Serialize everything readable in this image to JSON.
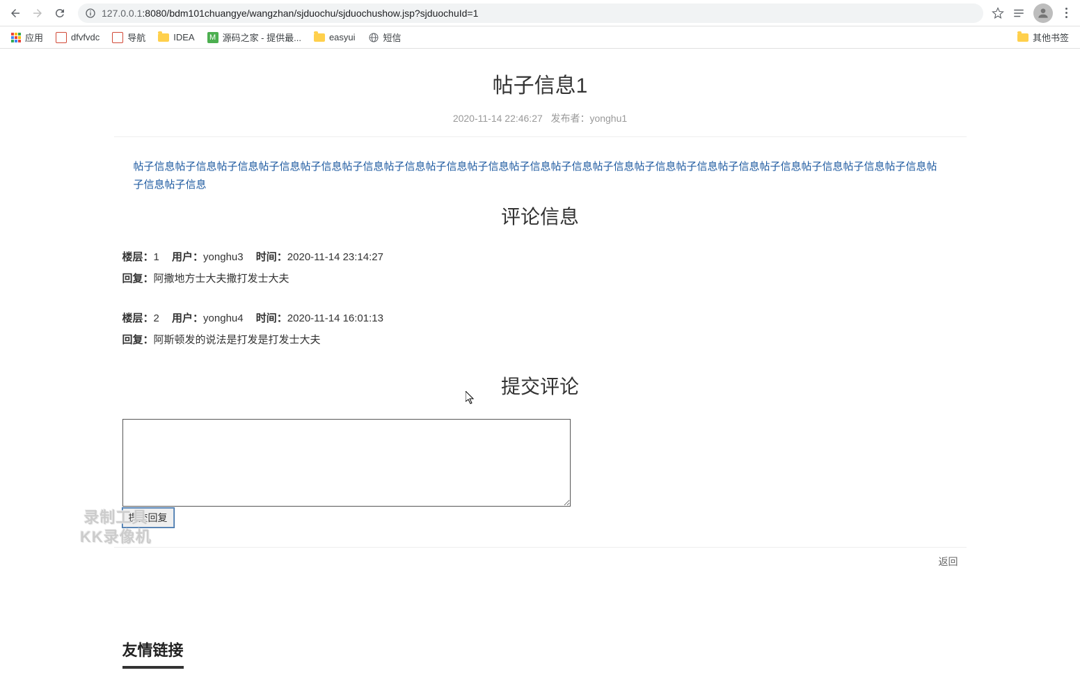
{
  "browser": {
    "url_host": "127.0.0.1",
    "url_path": ":8080/bdm101chuangye/wangzhan/sjduochu/sjduochushow.jsp?sjduochuId=1"
  },
  "bookmarks": {
    "apps": "应用",
    "items": [
      {
        "label": "dfvfvdc",
        "icon": "chart",
        "color": "#d14836"
      },
      {
        "label": "导航",
        "icon": "chart",
        "color": "#d14836"
      },
      {
        "label": "IDEA",
        "icon": "folder"
      },
      {
        "label": "源码之家 - 提供最...",
        "icon": "square",
        "color": "#4caf50"
      },
      {
        "label": "easyui",
        "icon": "folder"
      },
      {
        "label": "短信",
        "icon": "globe"
      }
    ],
    "other": "其他书签"
  },
  "post": {
    "title": "帖子信息1",
    "meta_time": "2020-11-14 22:46:27",
    "meta_author_label": "发布者：",
    "meta_author": "yonghu1",
    "body": "帖子信息帖子信息帖子信息帖子信息帖子信息帖子信息帖子信息帖子信息帖子信息帖子信息帖子信息帖子信息帖子信息帖子信息帖子信息帖子信息帖子信息帖子信息帖子信息帖子信息帖子信息"
  },
  "comments": {
    "title": "评论信息",
    "floor_label": "楼层：",
    "user_label": "用户：",
    "time_label": "时间：",
    "reply_label": "回复：",
    "items": [
      {
        "floor": "1",
        "user": "yonghu3",
        "time": "2020-11-14 23:14:27",
        "reply": "阿撒地方士大夫撒打发士大夫"
      },
      {
        "floor": "2",
        "user": "yonghu4",
        "time": "2020-11-14 16:01:13",
        "reply": "阿斯顿发的说法是打发是打发士大夫"
      }
    ]
  },
  "submit": {
    "title": "提交评论",
    "button": "提交回复"
  },
  "back_link": "返回",
  "footer": {
    "links_title": "友情链接"
  },
  "watermark": {
    "line1": "录制工具",
    "line2": "KK录像机"
  }
}
